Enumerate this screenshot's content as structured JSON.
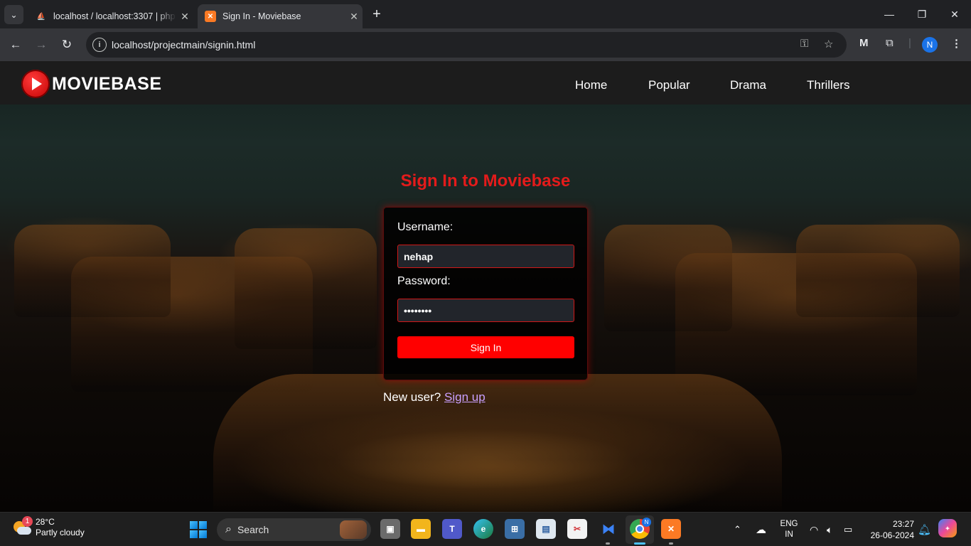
{
  "browser": {
    "tabs": [
      {
        "title": "localhost / localhost:3307 | phpMyAdmin",
        "active": false
      },
      {
        "title": "Sign In - Moviebase",
        "active": true
      }
    ],
    "url": "localhost/projectmain/signin.html",
    "profile_initial": "N"
  },
  "site": {
    "logo_text": "MOVIEBASE",
    "nav": [
      "Home",
      "Popular",
      "Drama",
      "Thrillers"
    ]
  },
  "signin": {
    "title": "Sign In to Moviebase",
    "username_label": "Username:",
    "username_value": "nehap",
    "password_label": "Password:",
    "password_value": "password",
    "submit_label": "Sign In",
    "new_user_text": "New user?",
    "signup_link": "Sign up"
  },
  "taskbar": {
    "weather_badge": "1",
    "weather_temp": "28°C",
    "weather_desc": "Partly cloudy",
    "search_label": "Search",
    "lang_line1": "ENG",
    "lang_line2": "IN",
    "time": "23:27",
    "date": "26-06-2024",
    "chrome_profile": "N"
  },
  "colors": {
    "accent_red": "#ff0000",
    "title_red": "#e31b1b",
    "link_purple": "#c9a0ff"
  }
}
